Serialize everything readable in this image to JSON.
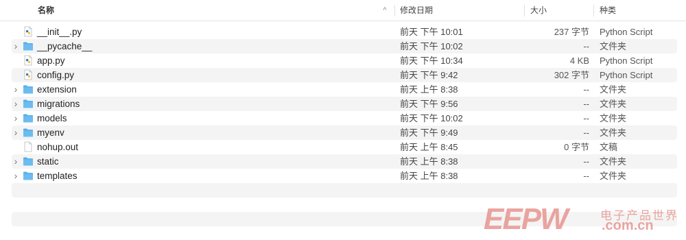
{
  "columns": {
    "name": "名称",
    "sort_indicator": "^",
    "date": "修改日期",
    "size": "大小",
    "kind": "种类"
  },
  "files": [
    {
      "name": "__init__.py",
      "type": "python",
      "expandable": false,
      "date": "前天 下午 10:01",
      "size": "237 字节",
      "kind": "Python Script"
    },
    {
      "name": "__pycache__",
      "type": "folder",
      "expandable": true,
      "date": "前天 下午 10:02",
      "size": "--",
      "kind": "文件夹"
    },
    {
      "name": "app.py",
      "type": "python",
      "expandable": false,
      "date": "前天 下午 10:34",
      "size": "4 KB",
      "kind": "Python Script"
    },
    {
      "name": "config.py",
      "type": "python",
      "expandable": false,
      "date": "前天 下午 9:42",
      "size": "302 字节",
      "kind": "Python Script"
    },
    {
      "name": "extension",
      "type": "folder",
      "expandable": true,
      "date": "前天 上午 8:38",
      "size": "--",
      "kind": "文件夹"
    },
    {
      "name": "migrations",
      "type": "folder",
      "expandable": true,
      "date": "前天 下午 9:56",
      "size": "--",
      "kind": "文件夹"
    },
    {
      "name": "models",
      "type": "folder",
      "expandable": true,
      "date": "前天 下午 10:02",
      "size": "--",
      "kind": "文件夹"
    },
    {
      "name": "myenv",
      "type": "folder",
      "expandable": true,
      "date": "前天 下午 9:49",
      "size": "--",
      "kind": "文件夹"
    },
    {
      "name": "nohup.out",
      "type": "document",
      "expandable": false,
      "date": "前天 上午 8:45",
      "size": "0 字节",
      "kind": "文稿"
    },
    {
      "name": "static",
      "type": "folder",
      "expandable": true,
      "date": "前天 上午 8:38",
      "size": "--",
      "kind": "文件夹"
    },
    {
      "name": "templates",
      "type": "folder",
      "expandable": true,
      "date": "前天 上午 8:38",
      "size": "--",
      "kind": "文件夹"
    }
  ],
  "icons": {
    "folder": "folder-icon",
    "python": "python-file-icon",
    "document": "document-icon",
    "chevron": "chevron-right-icon"
  },
  "colors": {
    "folder": "#5aaee8",
    "row_alt": "#f4f4f4",
    "watermark": "#e89590"
  },
  "watermark": {
    "logo": "EEPW",
    "cn": "电子产品世界",
    "url": ".com.cn"
  }
}
